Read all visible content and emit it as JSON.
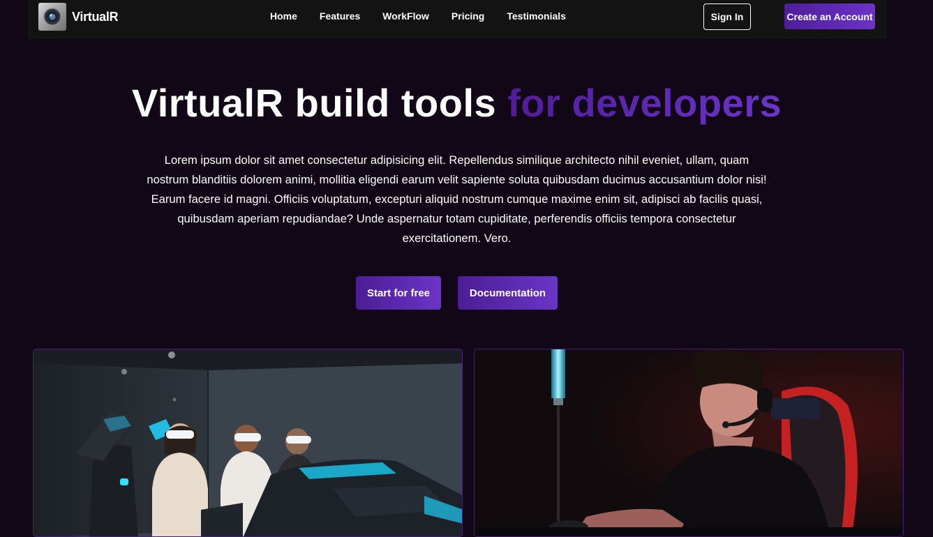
{
  "nav": {
    "brand": "VirtualR",
    "links": [
      "Home",
      "Features",
      "WorkFlow",
      "Pricing",
      "Testimonials"
    ],
    "signin_label": "Sign In",
    "create_account_label": "Create an Account"
  },
  "hero": {
    "title_main": "VirtualR build tools ",
    "title_accent": "for developers",
    "description": "Lorem ipsum dolor sit amet consectetur adipisicing elit. Repellendus similique architecto nihil eveniet, ullam, quam nostrum blanditiis dolorem animi, mollitia eligendi earum velit sapiente soluta quibusdam ducimus accusantium dolor nisi! Earum facere id magni. Officiis voluptatum, excepturi aliquid nostrum cumque maxime enim sit, adipisci ab facilis quasi, quibusdam aperiam repudiandae? Unde aspernatur totam cupiditate, perferendis officiis tempora consectetur exercitationem. Vero.",
    "primary_button": "Start for free",
    "secondary_button": "Documentation"
  },
  "colors": {
    "background": "#120716",
    "navbar": "#131313",
    "accent": "#5b26b0",
    "card_border": "#4a1e7e"
  }
}
